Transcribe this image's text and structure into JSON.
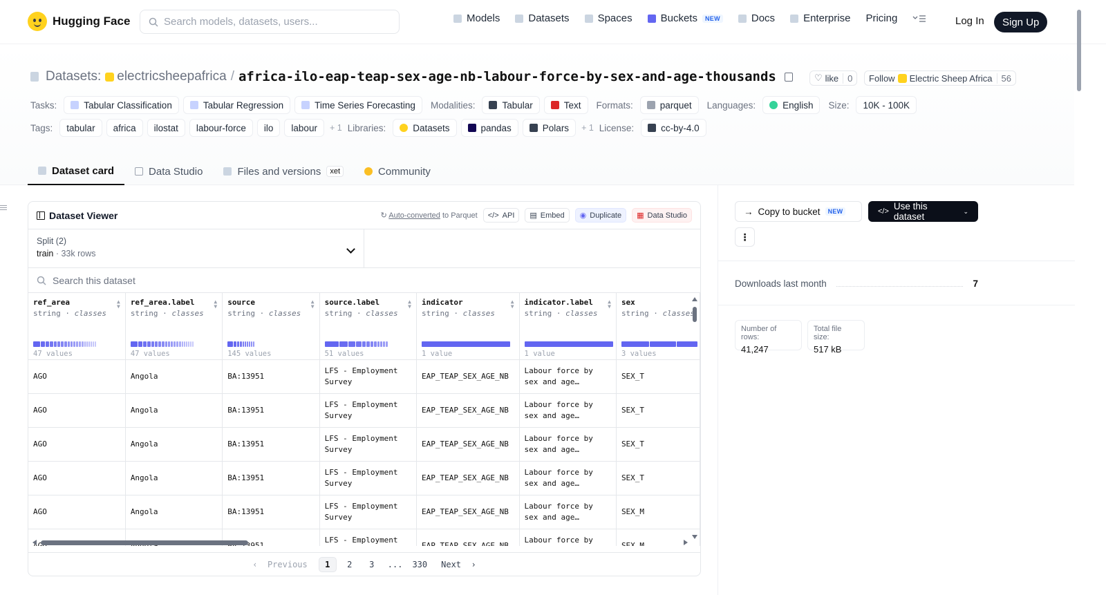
{
  "brand": {
    "name": "Hugging Face"
  },
  "search": {
    "placeholder": "Search models, datasets, users..."
  },
  "nav": {
    "items": [
      {
        "label": "Models",
        "icon": "cube-icon"
      },
      {
        "label": "Datasets",
        "icon": "database-icon"
      },
      {
        "label": "Spaces",
        "icon": "grid-icon"
      },
      {
        "label": "Buckets",
        "icon": "bucket-icon",
        "badge": "NEW"
      },
      {
        "label": "Docs",
        "icon": "book-icon"
      },
      {
        "label": "Enterprise",
        "icon": "enterprise-icon"
      },
      {
        "label": "Pricing"
      }
    ],
    "login": "Log In",
    "signup": "Sign Up"
  },
  "dataset": {
    "prefix": "Datasets:",
    "owner": "electricsheepafrica",
    "name": "africa-ilo-eap-teap-sex-age-nb-labour-force-by-sex-and-age-thousands",
    "like_label": "like",
    "like_count": "0",
    "follow_label": "Follow",
    "follow_org": "Electric Sheep Africa",
    "follow_count": "56"
  },
  "meta": {
    "tasks_label": "Tasks:",
    "tasks": [
      "Tabular Classification",
      "Tabular Regression",
      "Time Series Forecasting"
    ],
    "modalities_label": "Modalities:",
    "modalities": [
      "Tabular",
      "Text"
    ],
    "formats_label": "Formats:",
    "formats": [
      "parquet"
    ],
    "languages_label": "Languages:",
    "languages": [
      "English"
    ],
    "size_label": "Size:",
    "size": "10K - 100K",
    "tags_label": "Tags:",
    "tags": [
      "tabular",
      "africa",
      "ilostat",
      "labour-force",
      "ilo",
      "labour"
    ],
    "tags_more": "+ 1",
    "libraries_label": "Libraries:",
    "libraries": [
      "Datasets",
      "pandas",
      "Polars"
    ],
    "libraries_more": "+ 1",
    "license_label": "License:",
    "license": "cc-by-4.0"
  },
  "tabs": [
    {
      "label": "Dataset card",
      "active": true
    },
    {
      "label": "Data Studio"
    },
    {
      "label": "Files and versions",
      "badge": "xet"
    },
    {
      "label": "Community"
    }
  ],
  "viewer": {
    "title": "Dataset Viewer",
    "auto_converted": "Auto-converted",
    "to_parquet": "to Parquet",
    "api": "API",
    "embed": "Embed",
    "duplicate": "Duplicate",
    "data_studio": "Data Studio",
    "split_label": "Split (2)",
    "split_value": "train",
    "split_rows": "33k rows",
    "search_placeholder": "Search this dataset",
    "columns": [
      {
        "name": "ref_area",
        "type": "string",
        "kind": "classes",
        "values": "47 values"
      },
      {
        "name": "ref_area.label",
        "type": "string",
        "kind": "classes",
        "values": "47 values"
      },
      {
        "name": "source",
        "type": "string",
        "kind": "classes",
        "values": "145 values"
      },
      {
        "name": "source.label",
        "type": "string",
        "kind": "classes",
        "values": "51 values"
      },
      {
        "name": "indicator",
        "type": "string",
        "kind": "classes",
        "values": "1 value"
      },
      {
        "name": "indicator.label",
        "type": "string",
        "kind": "classes",
        "values": "1 value"
      },
      {
        "name": "sex",
        "type": "string",
        "kind": "classes",
        "values": "3 values"
      }
    ],
    "rows": [
      [
        "AGO",
        "Angola",
        "BA:13951",
        "LFS - Employment Survey",
        "EAP_TEAP_SEX_AGE_NB",
        "Labour force by sex and age…",
        "SEX_T"
      ],
      [
        "AGO",
        "Angola",
        "BA:13951",
        "LFS - Employment Survey",
        "EAP_TEAP_SEX_AGE_NB",
        "Labour force by sex and age…",
        "SEX_T"
      ],
      [
        "AGO",
        "Angola",
        "BA:13951",
        "LFS - Employment Survey",
        "EAP_TEAP_SEX_AGE_NB",
        "Labour force by sex and age…",
        "SEX_T"
      ],
      [
        "AGO",
        "Angola",
        "BA:13951",
        "LFS - Employment Survey",
        "EAP_TEAP_SEX_AGE_NB",
        "Labour force by sex and age…",
        "SEX_T"
      ],
      [
        "AGO",
        "Angola",
        "BA:13951",
        "LFS - Employment Survey",
        "EAP_TEAP_SEX_AGE_NB",
        "Labour force by sex and age…",
        "SEX_M"
      ],
      [
        "AGO",
        "Angola",
        "BA:13951",
        "LFS - Employment",
        "EAP_TEAP_SEX_AGE_NB",
        "Labour force by",
        "SEX_M"
      ]
    ],
    "pager": {
      "previous": "Previous",
      "pages": [
        "1",
        "2",
        "3",
        "...",
        "330"
      ],
      "next": "Next"
    }
  },
  "sidebar": {
    "copy_bucket": "Copy to bucket",
    "copy_badge": "NEW",
    "use_dataset": "Use this dataset",
    "more": "⋮",
    "downloads_label": "Downloads last month",
    "downloads_value": "7",
    "rows_label": "Number of rows:",
    "rows_value": "41,247",
    "size_label": "Total file size:",
    "size_value": "517 kB"
  },
  "colors": {
    "accent": "#6366f1",
    "dark": "#0b0f19",
    "brand_yellow": "#ffd21e"
  }
}
